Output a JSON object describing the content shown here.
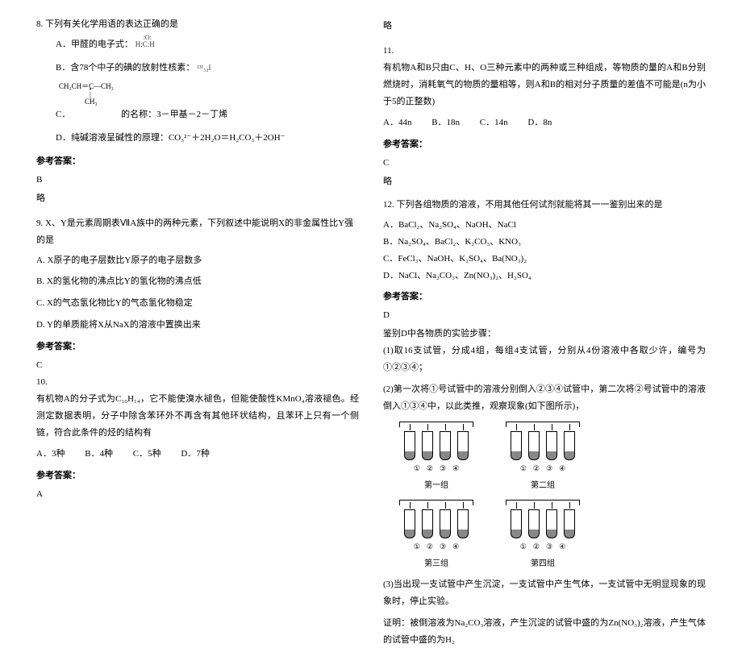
{
  "left": {
    "q8": {
      "title": "8. 下列有关化学用语的表达正确的是",
      "a_label": "A．甲醛的电子式：",
      "a_formula": "H:C:H",
      "b": "B．含78个中子的碘的放射性核素：",
      "b_formula": "¹³¹₅₃I",
      "c_prefix": "C．",
      "c_formula_upper": "CH₃CH＝C—CH₃",
      "c_formula_lower": "CH₃",
      "c_suffix": " 的名称：3－甲基－2－丁烯",
      "d": "D．纯碱溶液呈碱性的原理：CO₃²⁻＋2H₂O＝H₂CO₃＋2OH⁻",
      "ans_label": "参考答案：",
      "ans": "B",
      "note": "略"
    },
    "q9": {
      "title": "9. X、Y是元素周期表ⅦA族中的两种元素，下列叙述中能说明X的非金属性比Y强的是",
      "a": "A. X原子的电子层数比Y原子的电子层数多",
      "b": "B. X的氢化物的沸点比Y的氢化物的沸点低",
      "c": "C. X的气态氢化物比Y的气态氢化物稳定",
      "d": "D. Y的单质能将X从NaX的溶液中置换出来",
      "ans_label": "参考答案：",
      "ans": "C"
    },
    "q10": {
      "num": "10.",
      "body": "有机物A的分子式为C₁₀H₁₄，它不能使溴水褪色，但能使酸性KMnO₄溶液褪色。经测定数据表明，分子中除含苯环外不再含有其他环状结构，且苯环上只有一个侧链，符合此条件的烃的结构有",
      "opts": {
        "a": "A．3种",
        "b": "B．4种",
        "c": "C．5种",
        "d": "D．7种"
      },
      "ans_label": "参考答案：",
      "ans": "A"
    }
  },
  "right": {
    "note_top": "略",
    "q11": {
      "num": "11.",
      "body": "有机物A和B只由C、H、O三种元素中的两种或三种组成，等物质的量的A和B分别燃烧时，消耗氧气的物质的量相等，则A和B的相对分子质量的差值不可能是(n为小于5的正整数)",
      "opts": {
        "a": "A．44n",
        "b": "B．18n",
        "c": "C．14n",
        "d": "D．8n"
      },
      "ans_label": "参考答案：",
      "ans": "C",
      "note": "略"
    },
    "q12": {
      "title": "12. 下列各组物质的溶液，不用其他任何试剂就能将其一一鉴别出来的是",
      "a": "A．BaCl₂、Na₂SO₄、NaOH、NaCl",
      "b": "B．Na₂SO₄、BaCl₂、K₂CO₃、KNO₃",
      "c": "C．FeCl₃、NaOH、K₂SO₄、Ba(NO₃)₂",
      "d": "D．NaCl、Na₂CO₃、Zn(NO₃)₂、H₂SO₄",
      "ans_label": "参考答案：",
      "ans": "D",
      "exp_title": "鉴别D中各物质的实验步骤：",
      "step1": "(1)取16支试管，分成4组，每组4支试管，分别从4份溶液中各取少许，编号为①②③④；",
      "step2": "(2)第一次将①号试管中的溶液分别倒入②③④试管中，第二次将②号试管中的溶液倒入①③④中，以此类推，观察现象(如下图所示)，",
      "g1": "第一组",
      "g2": "第二组",
      "g3": "第三组",
      "g4": "第四组",
      "t1": "①",
      "t2": "②",
      "t3": "③",
      "t4": "④",
      "step3": "(3)当出现一支试管中产生沉淀，一支试管中产生气体，一支试管中无明显现象的现象时，停止实验。",
      "step4": "证明：被倒溶液为Na₂CO₃溶液，产生沉淀的试管中盛的为Zn(NO₃)₂溶液，产生气体的试管中盛的为H₂"
    }
  }
}
